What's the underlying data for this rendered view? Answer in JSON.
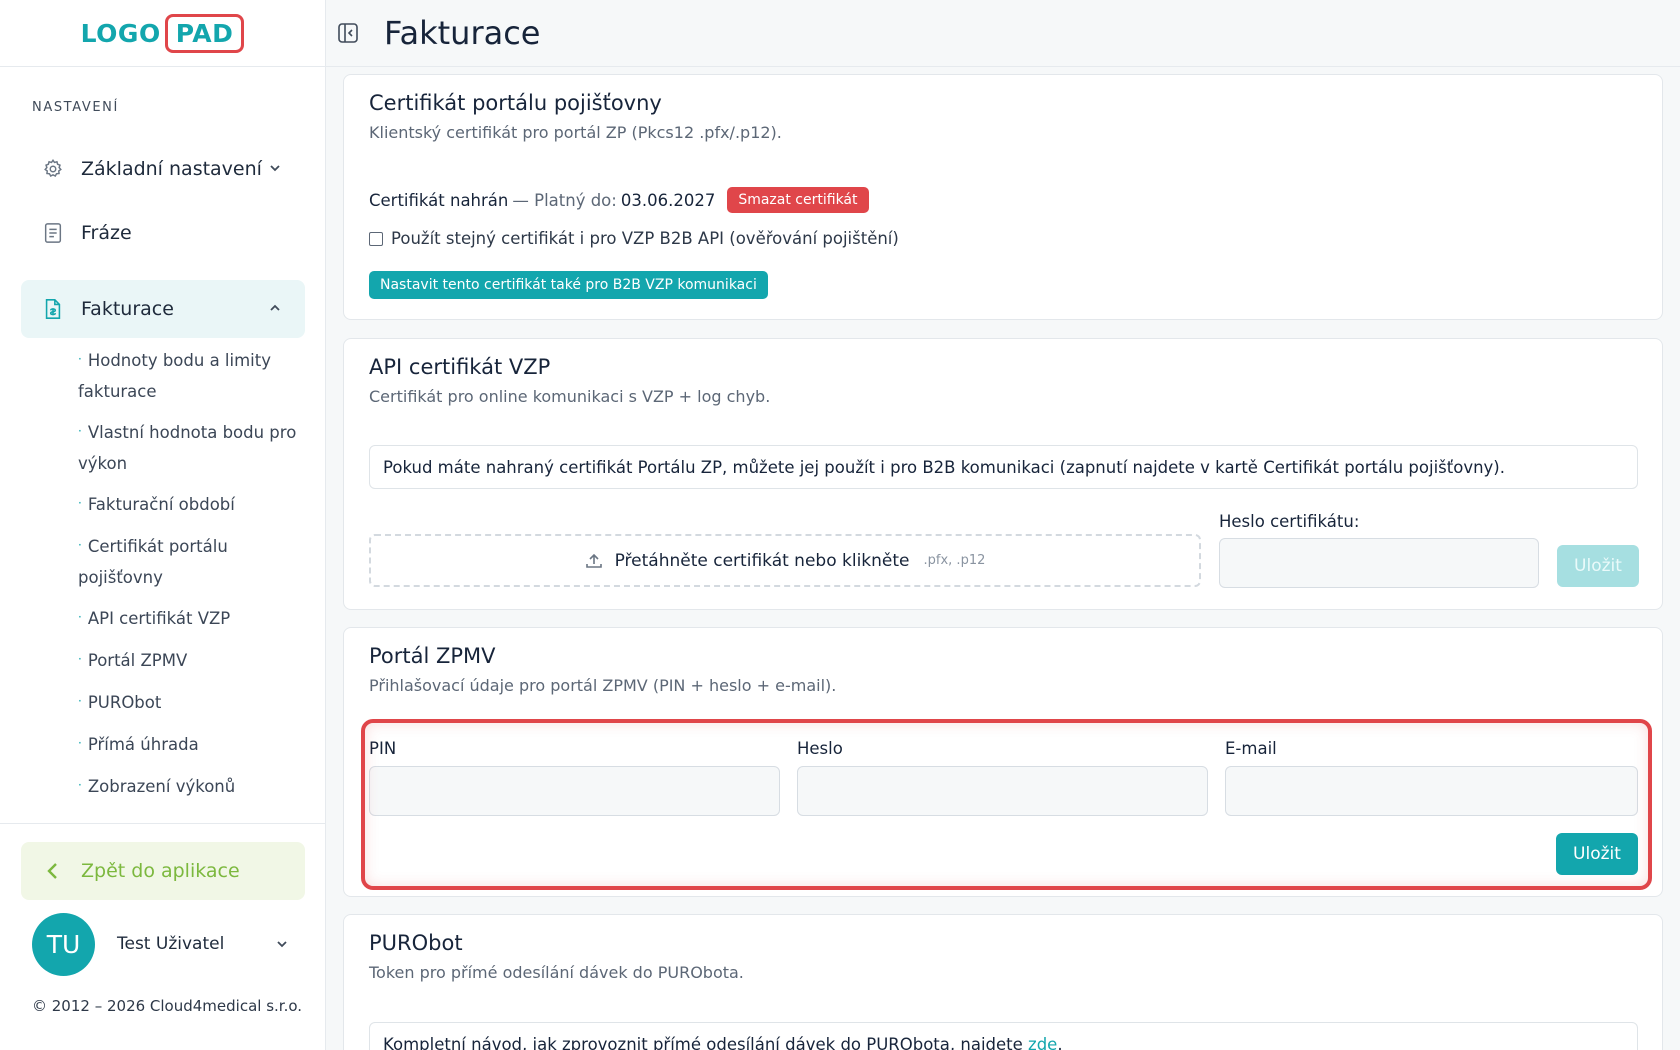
{
  "logo": {
    "part1": "LOGO",
    "part2": "PAD"
  },
  "sidebar": {
    "section_label": "NASTAVENÍ",
    "items": [
      {
        "label": "Základní nastavení",
        "icon": "gear-icon"
      },
      {
        "label": "Fráze",
        "icon": "document-icon"
      },
      {
        "label": "Fakturace",
        "icon": "invoice-icon"
      }
    ],
    "subitems": [
      "Hodnoty bodu a limity fakturace",
      "Vlastní hodnota bodu pro výkon",
      "Fakturační období",
      "Certifikát portálu pojišťovny",
      "API certifikát VZP",
      "Portál ZPMV",
      "PURObot",
      "Přímá úhrada",
      "Zobrazení výkonů"
    ],
    "back_label": "Zpět do aplikace",
    "user_initials": "TU",
    "user_name": "Test Uživatel",
    "copyright": "© 2012 – 2026 Cloud4medical s.r.o."
  },
  "header": {
    "title": "Fakturace"
  },
  "cards": {
    "cert_portal": {
      "title": "Certifikát portálu pojišťovny",
      "subtitle": "Klientský certifikát pro portál ZP (Pkcs12 .pfx/.p12).",
      "status_uploaded": "Certifikát nahrán",
      "status_valid_prefix": "— Platný do:",
      "status_valid_date": "03.06.2027",
      "delete_label": "Smazat certifikát",
      "checkbox_label": "Použít stejný certifikát i pro VZP B2B API (ověřování pojištění)",
      "set_b2b_label": "Nastavit tento certifikát také pro B2B VZP komunikaci"
    },
    "api_vzp": {
      "title": "API certifikát VZP",
      "subtitle": "Certifikát pro online komunikaci s VZP + log chyb.",
      "info": "Pokud máte nahraný certifikát Portálu ZP, můžete jej použít i pro B2B komunikaci (zapnutí najdete v kartě Certifikát portálu pojišťovny).",
      "dropzone_text": "Přetáhněte certifikát nebo klikněte",
      "dropzone_hint": ".pfx, .p12",
      "password_label": "Heslo certifikátu:",
      "password_value": "",
      "save_label": "Uložit"
    },
    "zpmv": {
      "title": "Portál ZPMV",
      "subtitle": "Přihlašovací údaje pro portál ZPMV (PIN + heslo + e-mail).",
      "pin_label": "PIN",
      "pin_value": "",
      "password_label": "Heslo",
      "password_value": "",
      "email_label": "E-mail",
      "email_value": "",
      "save_label": "Uložit"
    },
    "purobot": {
      "title": "PURObot",
      "subtitle": "Token pro přímé odesílání dávek do PURObota.",
      "info_text": "Kompletní návod, jak zprovoznit přímé odesílání dávek do PURObota, najdete",
      "info_link": "zde",
      "info_end": "."
    }
  },
  "colors": {
    "accent": "#13a6ad",
    "danger": "#e0464a",
    "back_green": "#7cb83e"
  }
}
